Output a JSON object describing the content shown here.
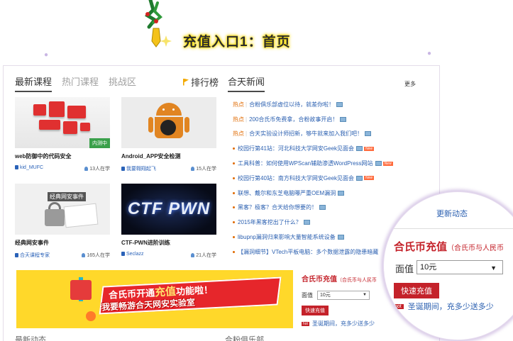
{
  "page_title": "充值入口1：首页",
  "tabs": [
    "最新课程",
    "热门课程",
    "挑战区"
  ],
  "ranking_label": "排行榜",
  "news_tab_label": "合天新闻",
  "more_label": "更多",
  "courses": [
    {
      "title": "web防御中的代码安全",
      "author": "kid_MUFC",
      "learners": "13人在学",
      "badge": "内测中"
    },
    {
      "title": "Android_APP安全检测",
      "author": "我要翱翔起飞",
      "learners": "15人在学"
    },
    {
      "title": "经典网安事件",
      "author": "合天课程专家",
      "learners": "165人在学",
      "thumb_text": "经典网安事件"
    },
    {
      "title": "CTF-PWN进阶训练",
      "author": "Seclazz",
      "learners": "21人在学",
      "thumb_text": "CTF PWN"
    }
  ],
  "hot_label": "热点",
  "news": [
    {
      "type": "hot",
      "text": "合粉俱乐部虚位以待，就差你啦！",
      "img": true
    },
    {
      "type": "hot",
      "text": "200合氏币免费拿，合粉故事开启！",
      "img": true
    },
    {
      "type": "hot",
      "text": "合天实验设计师招新，够牛就来加入我们吧！",
      "img": true
    },
    {
      "type": "bullet",
      "text": "校园行第41站：河北科技大学网安Geek见面会",
      "img": true,
      "new": true
    },
    {
      "type": "bullet",
      "text": "工具科普：如何使用WPScan辅助渗透WordPress网站",
      "img": true,
      "new": true
    },
    {
      "type": "bullet",
      "text": "校园行第40站：南方科技大学网安Geek见面会",
      "img": true,
      "new": true
    },
    {
      "type": "bullet",
      "text": "联想、戴尔和东芝电脑曝严重OEM漏洞",
      "img": true
    },
    {
      "type": "bullet",
      "text": "黑客？极客？合天给你想要的！",
      "img": true
    },
    {
      "type": "bullet",
      "text": "2015年黑客挖出了什么？",
      "img": true
    },
    {
      "type": "bullet",
      "text": "libupnp漏洞归来影响大量智能系统设备",
      "img": true
    },
    {
      "type": "bullet",
      "text": "【漏洞细节】VTech平板电脑：多个数据泄露的隐患暗藏",
      "img": false
    }
  ],
  "new_badge": "New",
  "banner": {
    "line1_a": "合氏币开通",
    "line1_hl": "充值",
    "line1_b": "功能啦！",
    "line2": "我要畅游合天网安实验室"
  },
  "recharge": {
    "title": "合氏币充值",
    "subtitle": "（合氏币与人民币",
    "face_label": "面值",
    "selected_value": "10元",
    "button_label": "快速充值",
    "hot_badge": "hot",
    "promo_text": "圣诞期间，充多少送多少"
  },
  "bottom_tabs": [
    "最新动态",
    "合粉俱乐部"
  ],
  "magnifier": {
    "fragment_text": "更新动态"
  }
}
